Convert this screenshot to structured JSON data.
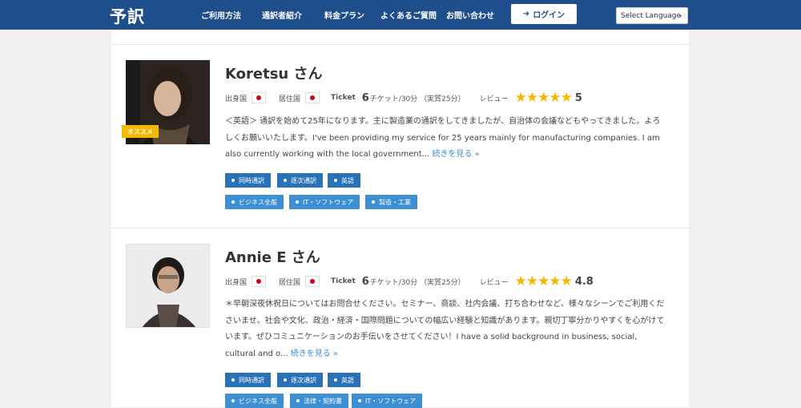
{
  "header": {
    "logo": "予訳",
    "nav": [
      "ご利用方法",
      "通訳者紹介",
      "料金プラン",
      "よくあるご質問",
      "お問い合わせ"
    ],
    "login_label": "ログイン",
    "language_select": "Select Language"
  },
  "interpreters": [
    {
      "name": "Koretsu さん",
      "badge": "オススメ",
      "origin_label": "出身国",
      "residence_label": "居住国",
      "ticket_label": "Ticket",
      "ticket_count": "6",
      "ticket_unit": "チケット/30分 （実質25分）",
      "review_label": "レビュー",
      "rating": 5,
      "rating_text": "5",
      "description": "＜英語＞ 通訳を始めて25年になります。主に製造業の通訳をしてきましたが、自治体の会議などもやってきました。よろしくお願いいたします。I've been providing my service for 25 years mainly for manufacturing companies. I am also currently working with the local government...",
      "read_more": "続きを見る »",
      "tags_row1": [
        "同時通訳",
        "逐次通訳",
        "英語"
      ],
      "tags_row2": [
        "ビジネス全般",
        "IT・ソフトウェア",
        "製造・工業"
      ]
    },
    {
      "name": "Annie E さん",
      "origin_label": "出身国",
      "residence_label": "居住国",
      "ticket_label": "Ticket",
      "ticket_count": "6",
      "ticket_unit": "チケット/30分 （実質25分）",
      "review_label": "レビュー",
      "rating": 4.8,
      "rating_text": "4.8",
      "description": "＊早朝深夜休祝日についてはお問合せください。セミナー、商談、社内会議、打ち合わせなど、様々なシーンでご利用くださいませ。社会や文化、政治・経済・国際問題についての幅広い経験と知識があります。親切丁寧分かりやすくを心がけています。ぜひコミュニケーションのお手伝いをさせてください！I have a solid background in business, social, cultural and o...",
      "read_more": "続きを見る »",
      "tags_row1": [
        "同時通訳",
        "逐次通訳",
        "英語"
      ],
      "tags_row2": [
        "ビジネス全般",
        "法律・契約書",
        "IT・ソフトウェア"
      ]
    }
  ],
  "colors": {
    "header": "#1f4e8c",
    "tag": "#2a72b8",
    "star": "#f5b800",
    "link": "#3a8fd1"
  }
}
